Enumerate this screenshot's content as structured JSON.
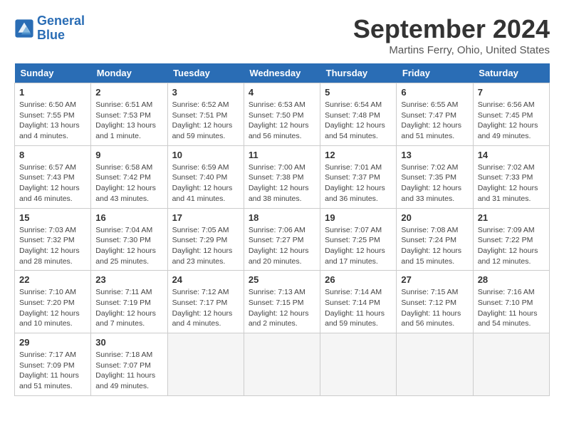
{
  "logo": {
    "line1": "General",
    "line2": "Blue"
  },
  "title": "September 2024",
  "subtitle": "Martins Ferry, Ohio, United States",
  "headers": [
    "Sunday",
    "Monday",
    "Tuesday",
    "Wednesday",
    "Thursday",
    "Friday",
    "Saturday"
  ],
  "weeks": [
    [
      {
        "day": "1",
        "content": "Sunrise: 6:50 AM\nSunset: 7:55 PM\nDaylight: 13 hours\nand 4 minutes."
      },
      {
        "day": "2",
        "content": "Sunrise: 6:51 AM\nSunset: 7:53 PM\nDaylight: 13 hours\nand 1 minute."
      },
      {
        "day": "3",
        "content": "Sunrise: 6:52 AM\nSunset: 7:51 PM\nDaylight: 12 hours\nand 59 minutes."
      },
      {
        "day": "4",
        "content": "Sunrise: 6:53 AM\nSunset: 7:50 PM\nDaylight: 12 hours\nand 56 minutes."
      },
      {
        "day": "5",
        "content": "Sunrise: 6:54 AM\nSunset: 7:48 PM\nDaylight: 12 hours\nand 54 minutes."
      },
      {
        "day": "6",
        "content": "Sunrise: 6:55 AM\nSunset: 7:47 PM\nDaylight: 12 hours\nand 51 minutes."
      },
      {
        "day": "7",
        "content": "Sunrise: 6:56 AM\nSunset: 7:45 PM\nDaylight: 12 hours\nand 49 minutes."
      }
    ],
    [
      {
        "day": "8",
        "content": "Sunrise: 6:57 AM\nSunset: 7:43 PM\nDaylight: 12 hours\nand 46 minutes."
      },
      {
        "day": "9",
        "content": "Sunrise: 6:58 AM\nSunset: 7:42 PM\nDaylight: 12 hours\nand 43 minutes."
      },
      {
        "day": "10",
        "content": "Sunrise: 6:59 AM\nSunset: 7:40 PM\nDaylight: 12 hours\nand 41 minutes."
      },
      {
        "day": "11",
        "content": "Sunrise: 7:00 AM\nSunset: 7:38 PM\nDaylight: 12 hours\nand 38 minutes."
      },
      {
        "day": "12",
        "content": "Sunrise: 7:01 AM\nSunset: 7:37 PM\nDaylight: 12 hours\nand 36 minutes."
      },
      {
        "day": "13",
        "content": "Sunrise: 7:02 AM\nSunset: 7:35 PM\nDaylight: 12 hours\nand 33 minutes."
      },
      {
        "day": "14",
        "content": "Sunrise: 7:02 AM\nSunset: 7:33 PM\nDaylight: 12 hours\nand 31 minutes."
      }
    ],
    [
      {
        "day": "15",
        "content": "Sunrise: 7:03 AM\nSunset: 7:32 PM\nDaylight: 12 hours\nand 28 minutes."
      },
      {
        "day": "16",
        "content": "Sunrise: 7:04 AM\nSunset: 7:30 PM\nDaylight: 12 hours\nand 25 minutes."
      },
      {
        "day": "17",
        "content": "Sunrise: 7:05 AM\nSunset: 7:29 PM\nDaylight: 12 hours\nand 23 minutes."
      },
      {
        "day": "18",
        "content": "Sunrise: 7:06 AM\nSunset: 7:27 PM\nDaylight: 12 hours\nand 20 minutes."
      },
      {
        "day": "19",
        "content": "Sunrise: 7:07 AM\nSunset: 7:25 PM\nDaylight: 12 hours\nand 17 minutes."
      },
      {
        "day": "20",
        "content": "Sunrise: 7:08 AM\nSunset: 7:24 PM\nDaylight: 12 hours\nand 15 minutes."
      },
      {
        "day": "21",
        "content": "Sunrise: 7:09 AM\nSunset: 7:22 PM\nDaylight: 12 hours\nand 12 minutes."
      }
    ],
    [
      {
        "day": "22",
        "content": "Sunrise: 7:10 AM\nSunset: 7:20 PM\nDaylight: 12 hours\nand 10 minutes."
      },
      {
        "day": "23",
        "content": "Sunrise: 7:11 AM\nSunset: 7:19 PM\nDaylight: 12 hours\nand 7 minutes."
      },
      {
        "day": "24",
        "content": "Sunrise: 7:12 AM\nSunset: 7:17 PM\nDaylight: 12 hours\nand 4 minutes."
      },
      {
        "day": "25",
        "content": "Sunrise: 7:13 AM\nSunset: 7:15 PM\nDaylight: 12 hours\nand 2 minutes."
      },
      {
        "day": "26",
        "content": "Sunrise: 7:14 AM\nSunset: 7:14 PM\nDaylight: 11 hours\nand 59 minutes."
      },
      {
        "day": "27",
        "content": "Sunrise: 7:15 AM\nSunset: 7:12 PM\nDaylight: 11 hours\nand 56 minutes."
      },
      {
        "day": "28",
        "content": "Sunrise: 7:16 AM\nSunset: 7:10 PM\nDaylight: 11 hours\nand 54 minutes."
      }
    ],
    [
      {
        "day": "29",
        "content": "Sunrise: 7:17 AM\nSunset: 7:09 PM\nDaylight: 11 hours\nand 51 minutes."
      },
      {
        "day": "30",
        "content": "Sunrise: 7:18 AM\nSunset: 7:07 PM\nDaylight: 11 hours\nand 49 minutes."
      },
      {
        "day": "",
        "content": ""
      },
      {
        "day": "",
        "content": ""
      },
      {
        "day": "",
        "content": ""
      },
      {
        "day": "",
        "content": ""
      },
      {
        "day": "",
        "content": ""
      }
    ]
  ]
}
